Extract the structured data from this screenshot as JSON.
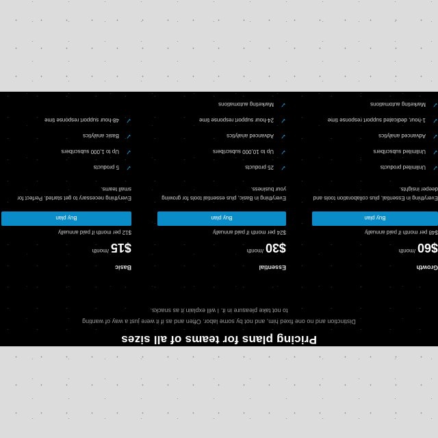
{
  "header": {
    "title": "Pricing plans for teams of all sizes",
    "subtitle": "Distinction and no one fixed him, and not by some labor. Often and as if it were just a way of wanting to not take pleasure in it. I will explain it as snacks."
  },
  "plans": [
    {
      "name": "Basic",
      "price": "$15",
      "period": "/month",
      "annual_note": "$12 per month if paid annually",
      "button_label": "Buy plan",
      "description": "Everything necessary to get started. Perfect for small teams.",
      "features": [
        "5 products",
        "Up to 1,000 subscribers",
        "Basic analytics",
        "48-hour support response time"
      ]
    },
    {
      "name": "Essential",
      "price": "$30",
      "period": "/month",
      "annual_note": "$24 per month if paid annually",
      "button_label": "Buy plan",
      "description": "Everything in Basic, plus essential tools for growing your business.",
      "features": [
        "25 products",
        "Up to 10,000 subscribers",
        "Advanced analytics",
        "24-hour support response time",
        "Marketing automations"
      ]
    },
    {
      "name": "Growth",
      "price": "$60",
      "period": "/month",
      "annual_note": "$48 per month if paid annually",
      "button_label": "Buy plan",
      "description": "Everything in Essential, plus collaboration tools and deeper insights.",
      "features": [
        "Unlimited products",
        "Unlimited subscribers",
        "Advanced analytics",
        "1-hour, dedicated support response time",
        "Marketing automations"
      ]
    }
  ],
  "colors": {
    "accent": "#0a8cc9",
    "background": "#000000",
    "page": "#dcdcdc"
  }
}
